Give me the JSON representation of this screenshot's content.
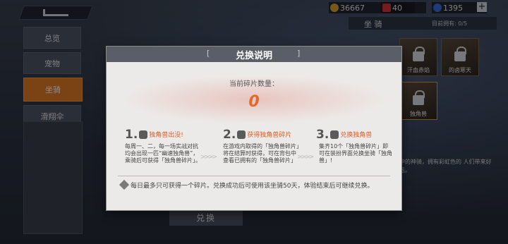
{
  "topbar": {
    "gold": "36667",
    "gems": "40",
    "coupons": "1395",
    "add_label": "+"
  },
  "sidebar": {
    "items": [
      {
        "label": "总览"
      },
      {
        "label": "宠物"
      },
      {
        "label": "坐骑"
      },
      {
        "label": "滑翔伞"
      }
    ]
  },
  "mounts": {
    "title": "坐 骑",
    "owned": "目前拥有: 0/5",
    "cards": [
      {
        "caption": "汗血赤焰"
      },
      {
        "caption": "的卤寒天"
      },
      {
        "caption": "独角兽"
      }
    ],
    "desc_fragment": "中的神骑，拥有彩虹色的 人们带来好运。"
  },
  "exchange_button_label": "兑换",
  "dialog": {
    "title": "兑换说明",
    "bracket_left": "[",
    "bracket_right": "]",
    "count_label": "当前碎片数量：",
    "count_value": "0",
    "steps": [
      {
        "num": "1.",
        "title": "独角兽出没!",
        "body": "每周一、二，每一场实战对抗均会出现一匹“幽速独角兽”，乘骑后可获得「独角兽碎片」。"
      },
      {
        "num": "2.",
        "title": "获得独角兽碎片",
        "body": "在游戏内取得的「独角兽碎片」将在结算时获得，可在背包中查看已拥有的「独角兽碎片」"
      },
      {
        "num": "3.",
        "title": "兑换独角兽",
        "body": "集齐10个「独角兽碎片」即可在装扮界面兑换坐骑「独角兽」!"
      }
    ],
    "arrows": ">>>>",
    "note": "每日最多只可获得一个碎片。兑换成功后可使用该坐骑50天，体验结束后可继续兑换。"
  }
}
